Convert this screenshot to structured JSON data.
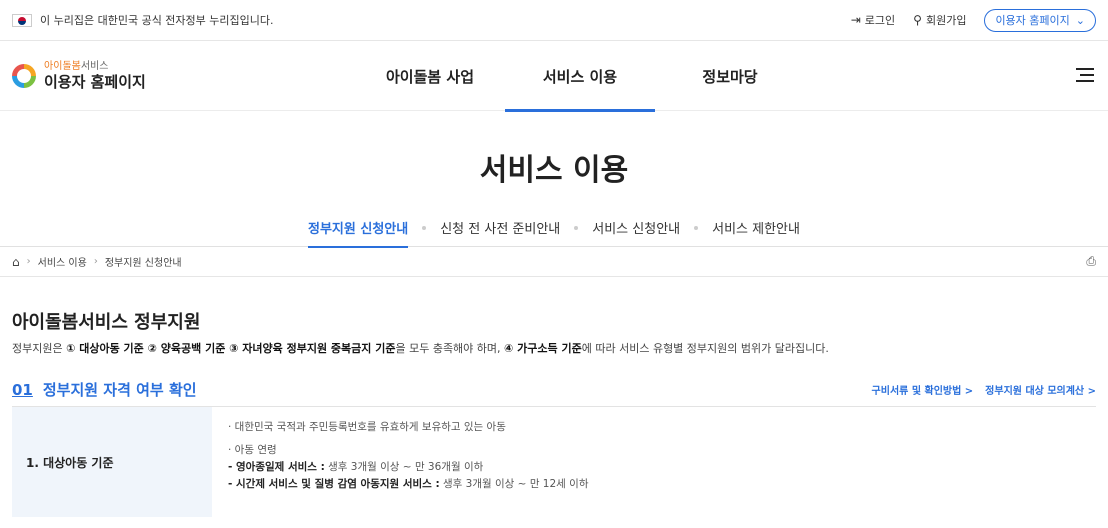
{
  "gov_bar": {
    "text": "이 누리집은 대한민국 공식 전자정부 누리집입니다.",
    "login": "로그인",
    "signup": "회원가입",
    "user_home": "이용자 홈페이지"
  },
  "header": {
    "logo_sub_a": "아이돌봄",
    "logo_sub_b": "서비스",
    "logo_title": "이용자 홈페이지",
    "nav": [
      "아이돌봄 사업",
      "서비스 이용",
      "정보마당"
    ]
  },
  "page_title": "서비스 이용",
  "subtabs": [
    "정부지원 신청안내",
    "신청 전 사전 준비안내",
    "서비스 신청안내",
    "서비스 제한안내"
  ],
  "breadcrumb": [
    "서비스 이용",
    "정부지원 신청안내"
  ],
  "content": {
    "heading": "아이돌봄서비스 정부지원",
    "desc_prefix": "정부지원은 ",
    "desc_b1": "① 대상아동 기준 ② 양육공백 기준 ③ 자녀양육 정부지원 중복금지 기준",
    "desc_mid": "을 모두 충족해야 하며, ",
    "desc_b2": "④ 가구소득 기준",
    "desc_suffix": "에 따라 서비스 유형별 정부지원의 범위가 달라집니다.",
    "section_num": "01",
    "section_title": "정부지원 자격 여부 확인",
    "section_link1": "구비서류 및 확인방법 >",
    "section_link2": "정부지원 대상 모의계산 >",
    "row_label": "1. 대상아동 기준",
    "line1": "· 대한민국 국적과 주민등록번호를 유효하게 보유하고 있는 아동",
    "line2": "· 아동 연령",
    "line3_b": "- 영아종일제 서비스 :",
    "line3": " 생후 3개월 이상 ~ 만 36개월 이하",
    "line4_b": "- 시간제 서비스 및 질병 감염 아동지원 서비스 :",
    "line4": " 생후 3개월 이상 ~ 만 12세 이하"
  }
}
